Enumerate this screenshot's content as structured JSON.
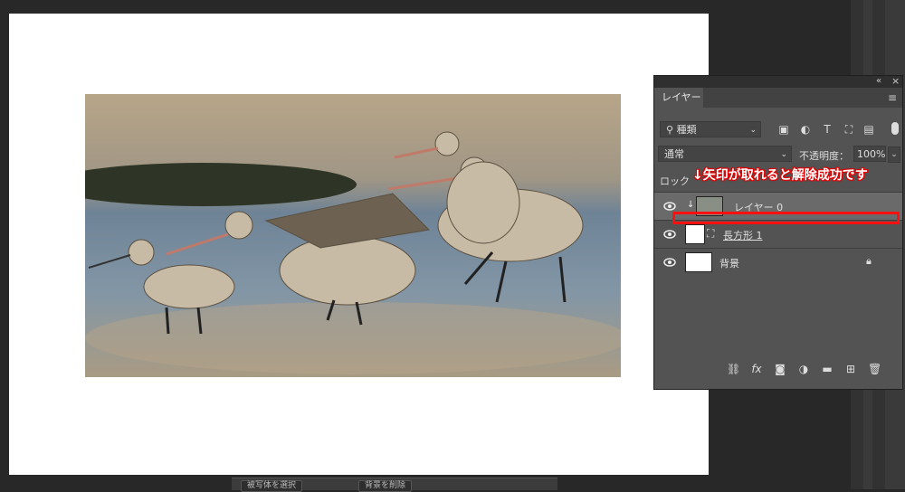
{
  "panel": {
    "tab_label": "レイヤー",
    "filter_kind": "種類",
    "blend_mode": "通常",
    "opacity_label": "不透明度：",
    "opacity_value": "100%",
    "lock_label": "ロック",
    "annotation": "↓矢印が取れると解除成功です",
    "layers": [
      {
        "name": "レイヤー 0"
      },
      {
        "name": "長方形 1"
      },
      {
        "name": "背景"
      }
    ],
    "bottom_icons": [
      "link-icon",
      "fx-icon",
      "mask-icon",
      "adjustment-icon",
      "folder-icon",
      "new-layer-icon",
      "trash-icon"
    ]
  },
  "taskbar": {
    "btn1": "被写体を選択",
    "btn2": "背景を削除"
  },
  "colors": {
    "annotation_red": "#ff1010",
    "panel_bg": "#535353",
    "workspace_bg": "#282828"
  }
}
